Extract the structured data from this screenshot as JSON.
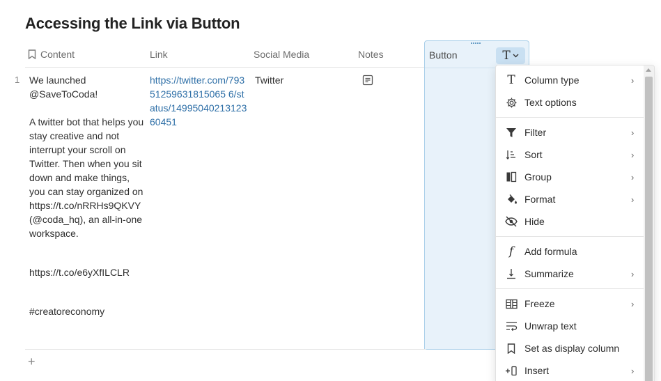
{
  "page": {
    "title": "Accessing the Link via Button"
  },
  "table": {
    "columns": {
      "content": "Content",
      "link": "Link",
      "social": "Social Media",
      "notes": "Notes",
      "button": "Button"
    },
    "row": {
      "number": "1",
      "content": {
        "p1": "We launched @SaveToCoda!",
        "p2": "A twitter bot that helps you stay creative and not interrupt your scroll on Twitter. Then when you sit down and make things, you can stay organized on https://t.co/nRRHs9QKVY (@coda_hq), an all-in-one workspace.",
        "p3": "https://t.co/e6yXfILCLR",
        "p4": "#creatoreconomy"
      },
      "link": "https://twitter.com/79351259631815065 6/status/1499504021312360451",
      "social": "Twitter"
    },
    "add_row": "+"
  },
  "menu": {
    "items": [
      {
        "label": "Column type",
        "icon": "type-icon",
        "chevron": true
      },
      {
        "label": "Text options",
        "icon": "gear-icon",
        "chevron": false
      },
      {
        "label": "Filter",
        "icon": "filter-icon",
        "chevron": true
      },
      {
        "label": "Sort",
        "icon": "sort-icon",
        "chevron": true
      },
      {
        "label": "Group",
        "icon": "group-icon",
        "chevron": true
      },
      {
        "label": "Format",
        "icon": "paint-bucket-icon",
        "chevron": true
      },
      {
        "label": "Hide",
        "icon": "eye-slash-icon",
        "chevron": false
      },
      {
        "label": "Add formula",
        "icon": "formula-icon",
        "chevron": false
      },
      {
        "label": "Summarize",
        "icon": "summarize-icon",
        "chevron": true
      },
      {
        "label": "Freeze",
        "icon": "freeze-icon",
        "chevron": true
      },
      {
        "label": "Unwrap text",
        "icon": "wrap-icon",
        "chevron": false
      },
      {
        "label": "Set as display column",
        "icon": "bookmark-icon",
        "chevron": false
      },
      {
        "label": "Insert",
        "icon": "insert-column-icon",
        "chevron": true
      }
    ],
    "chevron_glyph": "›"
  },
  "colors": {
    "selected_column_bg": "#e8f2fa",
    "selected_column_border": "#a9cfe9",
    "link": "#2e6fa7"
  }
}
